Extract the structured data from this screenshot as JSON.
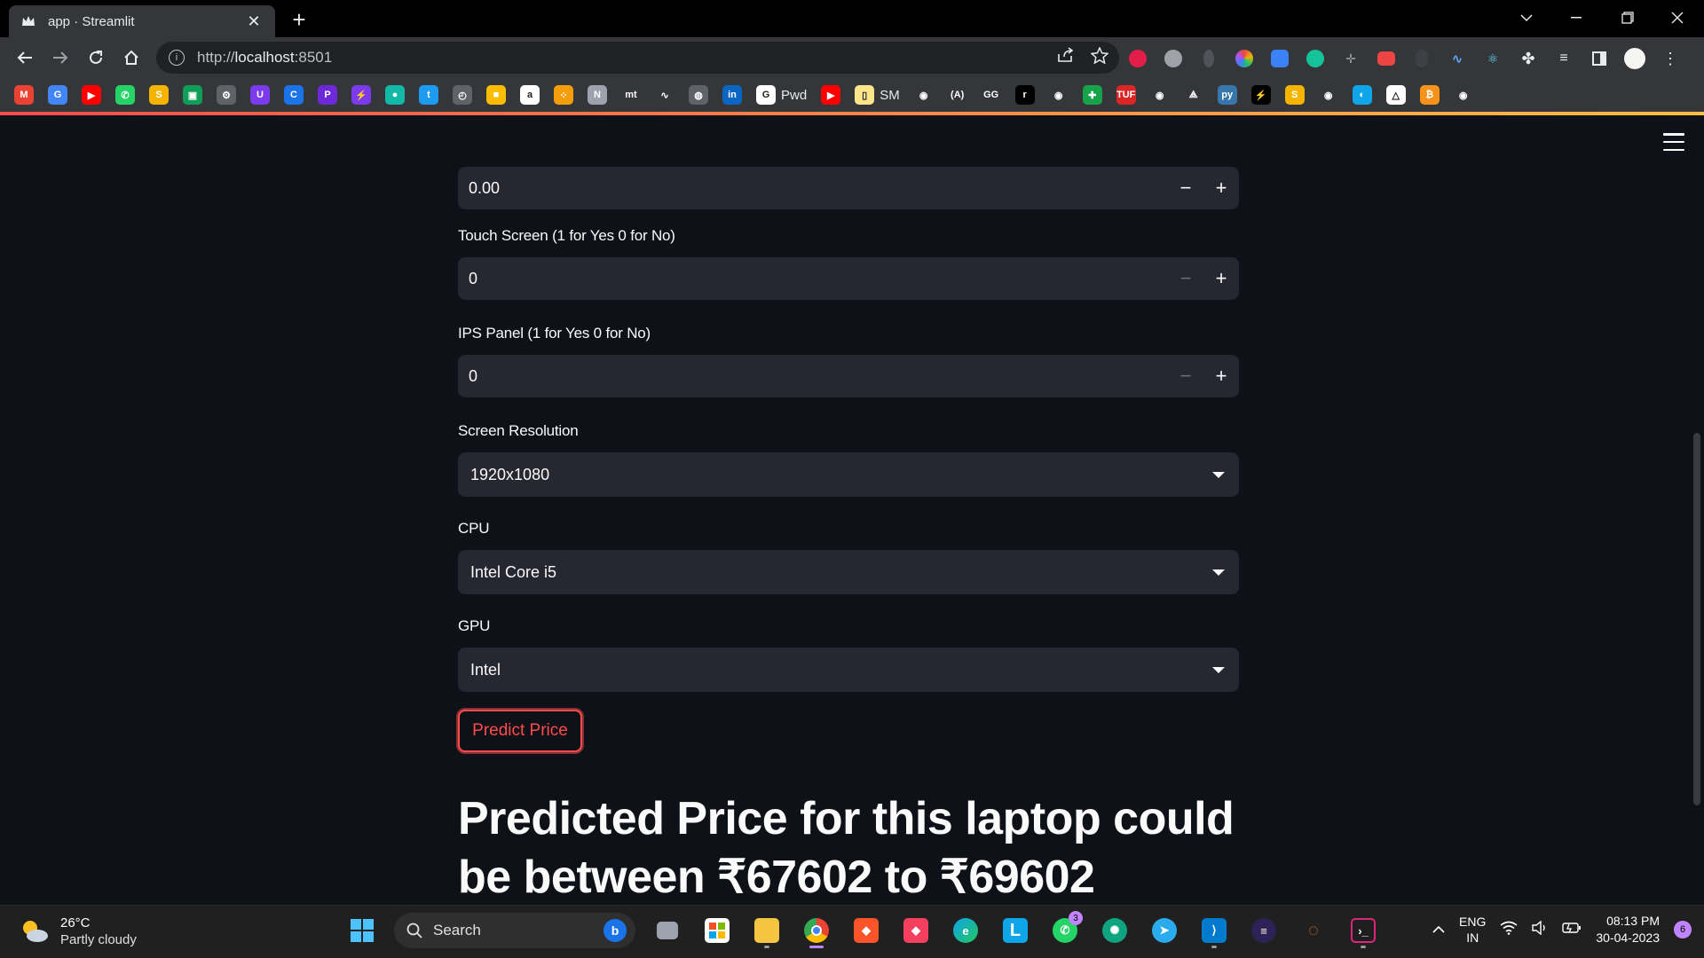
{
  "browser": {
    "tab_title": "app · Streamlit",
    "tab_close": "✕",
    "new_tab": "+",
    "url_host": "localhost",
    "url_prefix": "http://",
    "url_suffix": ":8501",
    "bookmarks": [
      {
        "label": "",
        "icon": "gmail-icon",
        "color": "#ea4335",
        "glyph": "M"
      },
      {
        "label": "",
        "icon": "translate-icon",
        "color": "#4285f4",
        "glyph": "G"
      },
      {
        "label": "",
        "icon": "youtube-icon",
        "color": "#ff0000",
        "glyph": "▶"
      },
      {
        "label": "",
        "icon": "whatsapp-icon",
        "color": "#25d366",
        "glyph": "✆"
      },
      {
        "label": "",
        "icon": "slides-icon",
        "color": "#f4b400",
        "glyph": "S"
      },
      {
        "label": "",
        "icon": "classroom-icon",
        "color": "#0f9d58",
        "glyph": "▣"
      },
      {
        "label": "",
        "icon": "tool-icon",
        "color": "#5f6368",
        "glyph": "⚙"
      },
      {
        "label": "",
        "icon": "u-icon",
        "color": "#7c3aed",
        "glyph": "U"
      },
      {
        "label": "",
        "icon": "c-icon",
        "color": "#1a73e8",
        "glyph": "C"
      },
      {
        "label": "",
        "icon": "p-icon",
        "color": "#6d28d9",
        "glyph": "P"
      },
      {
        "label": "",
        "icon": "bolt-icon",
        "color": "#7c3aed",
        "glyph": "⚡"
      },
      {
        "label": "",
        "icon": "leaf-icon",
        "color": "#14b8a6",
        "glyph": "●"
      },
      {
        "label": "",
        "icon": "twitter-icon",
        "color": "#1d9bf0",
        "glyph": "t"
      },
      {
        "label": "",
        "icon": "clock-icon",
        "color": "#5f6368",
        "glyph": "◴"
      },
      {
        "label": "",
        "icon": "keep-icon",
        "color": "#fbbc04",
        "glyph": "■"
      },
      {
        "label": "",
        "icon": "amazon-icon",
        "color": "#ffffff",
        "glyph": "a"
      },
      {
        "label": "",
        "icon": "dots-icon",
        "color": "#f59e0b",
        "glyph": "⁘"
      },
      {
        "label": "",
        "icon": "notion-icon",
        "color": "#9ca3af",
        "glyph": "N"
      },
      {
        "label": "",
        "icon": "mt-icon",
        "color": "#35363a",
        "glyph": "mt"
      },
      {
        "label": "",
        "icon": "chart-icon",
        "color": "#35363a",
        "glyph": "∿"
      },
      {
        "label": "",
        "icon": "globe-icon",
        "color": "#5f6368",
        "glyph": "◍"
      },
      {
        "label": "",
        "icon": "linkedin-icon",
        "color": "#0a66c2",
        "glyph": "in"
      },
      {
        "label": "Pwd",
        "icon": "google-icon",
        "color": "#ffffff",
        "glyph": "G"
      },
      {
        "label": "",
        "icon": "youtube-icon",
        "color": "#ff0000",
        "glyph": "▶"
      },
      {
        "label": "SM",
        "icon": "note-icon",
        "color": "#fde68a",
        "glyph": "▯"
      },
      {
        "label": "",
        "icon": "github-icon",
        "color": "#35363a",
        "glyph": "◉"
      },
      {
        "label": "",
        "icon": "a-icon",
        "color": "#35363a",
        "glyph": "(A)"
      },
      {
        "label": "",
        "icon": "gfg-icon",
        "color": "#35363a",
        "glyph": "GG"
      },
      {
        "label": "",
        "icon": "r-icon",
        "color": "#000000",
        "glyph": "r"
      },
      {
        "label": "",
        "icon": "github-icon",
        "color": "#35363a",
        "glyph": "◉"
      },
      {
        "label": "",
        "icon": "plus-green-icon",
        "color": "#16a34a",
        "glyph": "✚"
      },
      {
        "label": "",
        "icon": "tuf-icon",
        "color": "#dc2626",
        "glyph": "TUF"
      },
      {
        "label": "",
        "icon": "github-icon",
        "color": "#35363a",
        "glyph": "◉"
      },
      {
        "label": "",
        "icon": "tri-icon",
        "color": "#35363a",
        "glyph": "⟁"
      },
      {
        "label": "",
        "icon": "python-icon",
        "color": "#3776ab",
        "glyph": "py"
      },
      {
        "label": "",
        "icon": "flash-icon",
        "color": "#000000",
        "glyph": "⚡"
      },
      {
        "label": "",
        "icon": "slides-icon",
        "color": "#f4b400",
        "glyph": "S"
      },
      {
        "label": "",
        "icon": "github-icon",
        "color": "#35363a",
        "glyph": "◉"
      },
      {
        "label": "",
        "icon": "react-icon",
        "color": "#0ea5e9",
        "glyph": "◐"
      },
      {
        "label": "",
        "icon": "drive-icon",
        "color": "#ffffff",
        "glyph": "△"
      },
      {
        "label": "",
        "icon": "bitcoin-icon",
        "color": "#f7931a",
        "glyph": "₿"
      },
      {
        "label": "",
        "icon": "github-icon",
        "color": "#35363a",
        "glyph": "◉"
      }
    ]
  },
  "app": {
    "fields": [
      {
        "type": "number",
        "label": "",
        "value": "0.00",
        "minus_disabled": false
      },
      {
        "type": "number",
        "label": "Touch Screen (1 for Yes 0 for No)",
        "value": "0",
        "minus_disabled": true
      },
      {
        "type": "number",
        "label": "IPS Panel (1 for Yes 0 for No)",
        "value": "0",
        "minus_disabled": true
      },
      {
        "type": "select",
        "label": "Screen Resolution",
        "value": "1920x1080"
      },
      {
        "type": "select",
        "label": "CPU",
        "value": "Intel Core i5"
      },
      {
        "type": "select",
        "label": "GPU",
        "value": "Intel"
      }
    ],
    "predict_button": "Predict Price",
    "result_line1": "Predicted Price for this laptop could",
    "result_line2": "be between ₹67602 to ₹69602",
    "minus_glyph": "−",
    "plus_glyph": "+"
  },
  "taskbar": {
    "weather_temp": "26°C",
    "weather_cond": "Partly cloudy",
    "search_label": "Search",
    "lang_line1": "ENG",
    "lang_line2": "IN",
    "time": "08:13 PM",
    "date": "30-04-2023",
    "notif_count": "6",
    "whatsapp_badge": "3"
  },
  "colors": {
    "background": "#0e1117",
    "widget": "#262730",
    "accent": "#ff4b4b"
  }
}
